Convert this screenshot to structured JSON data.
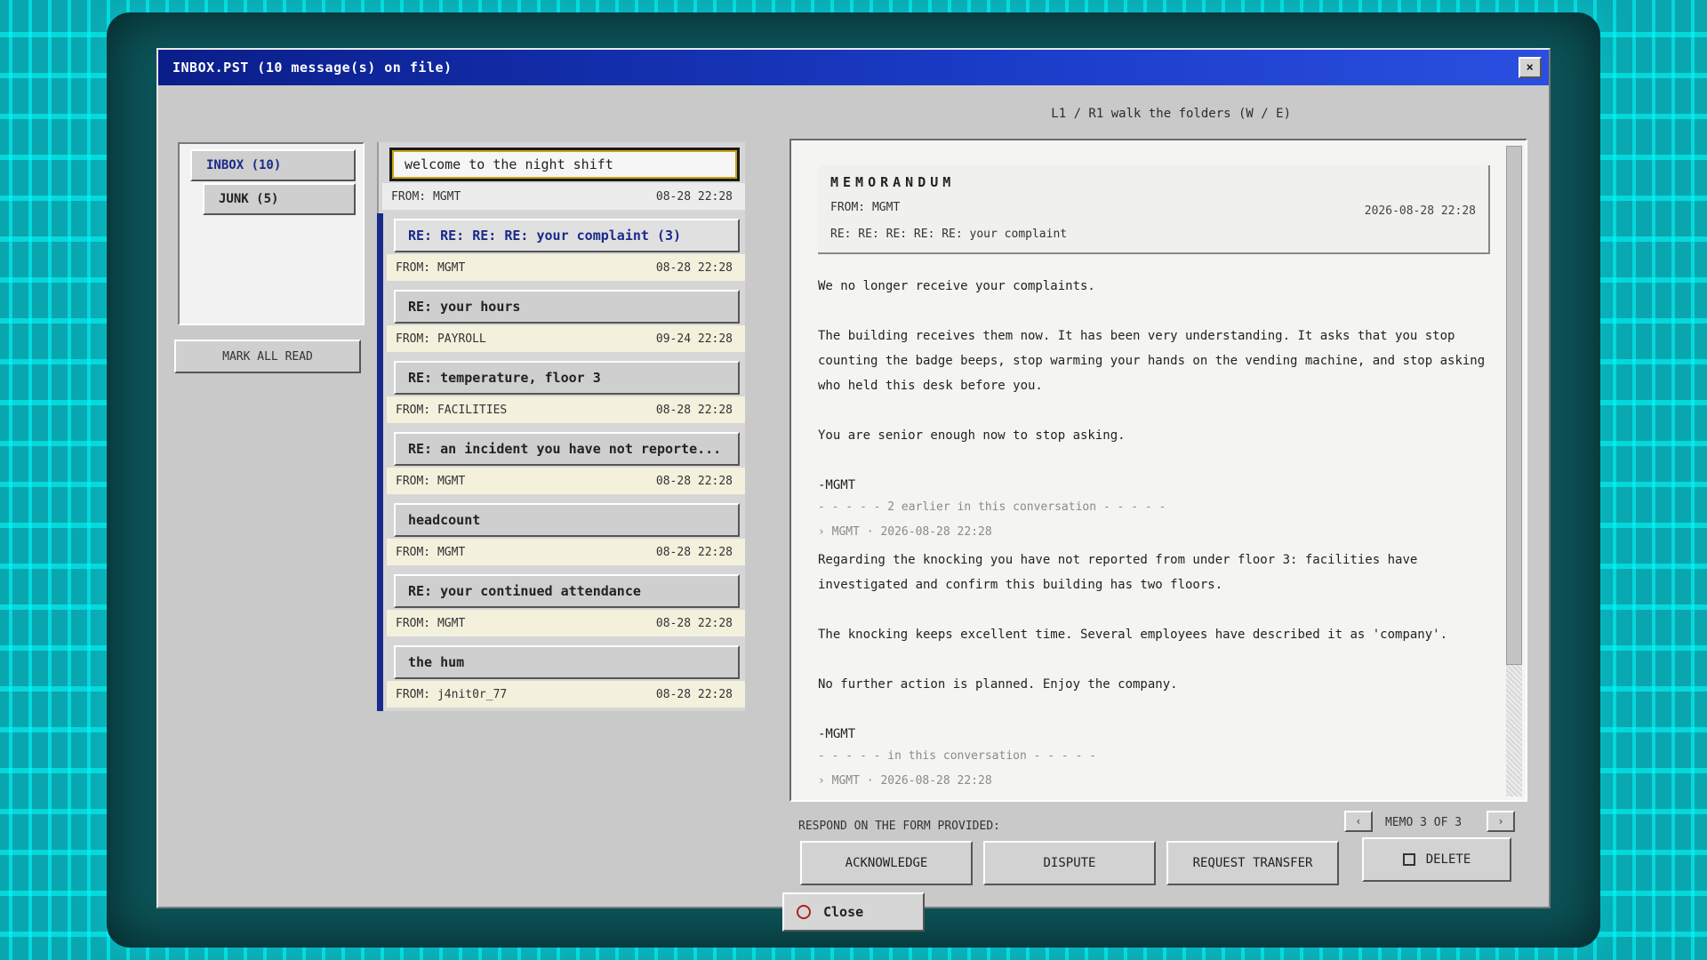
{
  "window": {
    "title": "INBOX.PST  (10 message(s) on file)",
    "close_glyph": "×",
    "hint": "L1 / R1 walk the folders  (W / E)"
  },
  "folders": [
    {
      "label": "INBOX  (10)"
    },
    {
      "label": "JUNK  (5)"
    }
  ],
  "mark_all_read": "MARK ALL READ",
  "messages": [
    {
      "subject": "welcome to the night shift",
      "from": "FROM: MGMT",
      "date": "08-28 22:28"
    },
    {
      "subject": "RE: RE: RE: RE: your complaint  (3)",
      "from": "FROM: MGMT",
      "date": "08-28 22:28"
    },
    {
      "subject": "RE: your hours",
      "from": "FROM: PAYROLL",
      "date": "09-24 22:28"
    },
    {
      "subject": "RE: temperature, floor 3",
      "from": "FROM: FACILITIES",
      "date": "08-28 22:28"
    },
    {
      "subject": "RE: an incident you have not reporte...",
      "from": "FROM: MGMT",
      "date": "08-28 22:28"
    },
    {
      "subject": "headcount",
      "from": "FROM: MGMT",
      "date": "08-28 22:28"
    },
    {
      "subject": "RE: your continued attendance",
      "from": "FROM: MGMT",
      "date": "08-28 22:28"
    },
    {
      "subject": "the hum",
      "from": "FROM: j4nit0r_77",
      "date": "08-28 22:28"
    }
  ],
  "memo": {
    "title": "MEMORANDUM",
    "from": "FROM:  MGMT",
    "date": "2026-08-28 22:28",
    "re": "RE:   RE: RE: RE: RE: your complaint",
    "body": [
      "We no longer receive your complaints.",
      "The building receives them now. It has been very understanding. It asks that you stop counting the badge beeps, stop warming your hands on the vending machine, and stop asking who held this desk before you.",
      "You are senior enough now to stop asking."
    ],
    "signature": "-MGMT",
    "divider1": "- - - - -  2 earlier in this conversation  - - - - -",
    "quote1_meta": "› MGMT  ·  2026-08-28 22:28",
    "quote1_body": [
      "Regarding the knocking you have not reported from under floor 3: facilities have investigated and confirm this building has two floors.",
      "The knocking keeps excellent time. Several employees have described it as 'company'.",
      "No further action is planned. Enjoy the company."
    ],
    "quote1_signature": "-MGMT",
    "divider2": "- - - - -  in this conversation  - - - - -",
    "quote2_meta": "› MGMT  ·  2026-08-28 22:28"
  },
  "respond": {
    "label": "RESPOND ON THE FORM PROVIDED:",
    "acknowledge": "ACKNOWLEDGE",
    "dispute": "DISPUTE",
    "request_transfer": "REQUEST TRANSFER",
    "delete": "DELETE"
  },
  "pager": {
    "prev": "‹",
    "next": "›",
    "label": "MEMO 3 OF 3"
  },
  "close_label": "Close"
}
